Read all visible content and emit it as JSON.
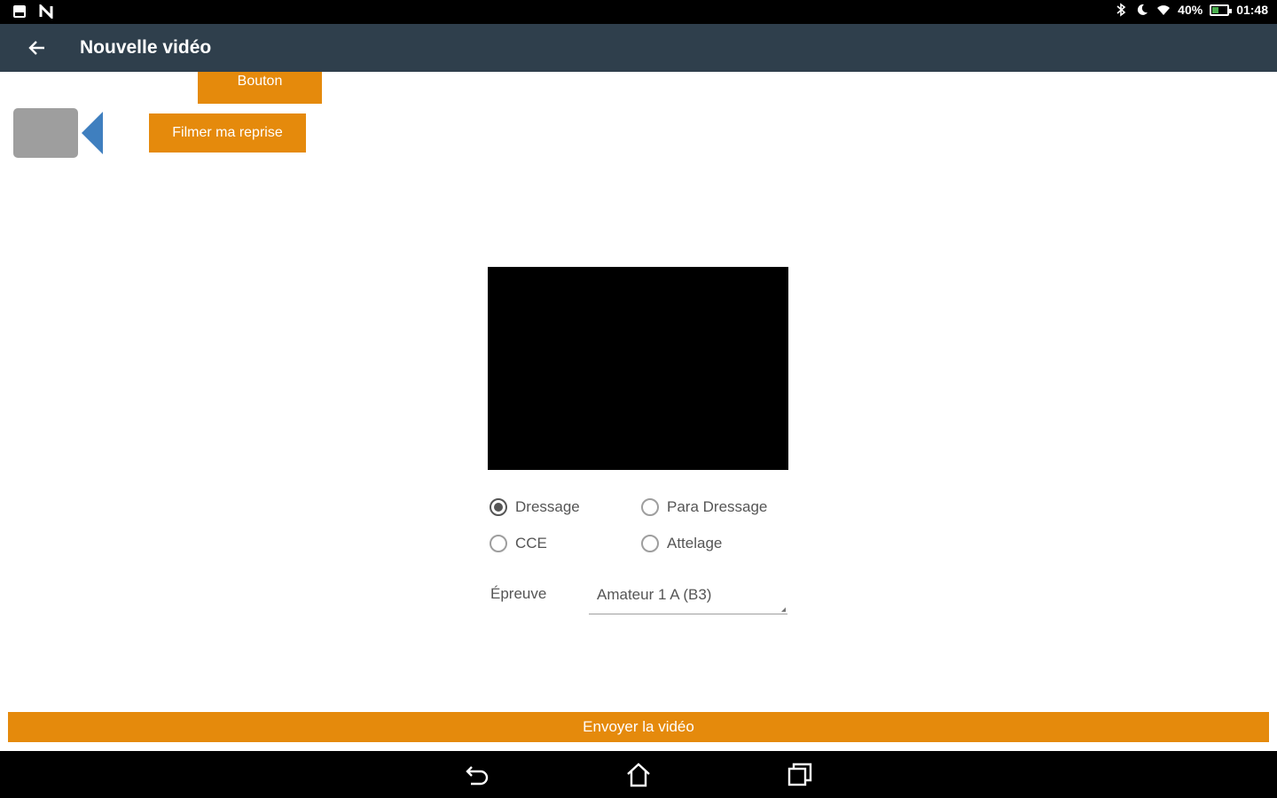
{
  "status_bar": {
    "left_icons": [
      "image-notification-icon",
      "n-notification-icon"
    ],
    "battery": "40%",
    "time": "01:48",
    "battery_level": 0.4
  },
  "app_bar": {
    "title": "Nouvelle vidéo",
    "back_icon": "arrow-back-icon"
  },
  "toolbar": {
    "bouton_label": "Bouton",
    "filmer_label": "Filmer ma reprise"
  },
  "colors": {
    "accent": "#e58a0c",
    "app_bar": "#2f3f4c",
    "camera_body": "#9e9e9e",
    "camera_lens": "#3f7fbf"
  },
  "discipline": {
    "options": [
      {
        "label": "Dressage",
        "checked": true
      },
      {
        "label": "Para Dressage",
        "checked": false
      },
      {
        "label": "CCE",
        "checked": false
      },
      {
        "label": "Attelage",
        "checked": false
      }
    ]
  },
  "epreuve": {
    "label": "Épreuve",
    "selected": "Amateur 1 A (B3)"
  },
  "send_label": "Envoyer la vidéo",
  "nav_bar": {
    "icons": [
      "back-nav-icon",
      "home-nav-icon",
      "recents-nav-icon"
    ]
  }
}
